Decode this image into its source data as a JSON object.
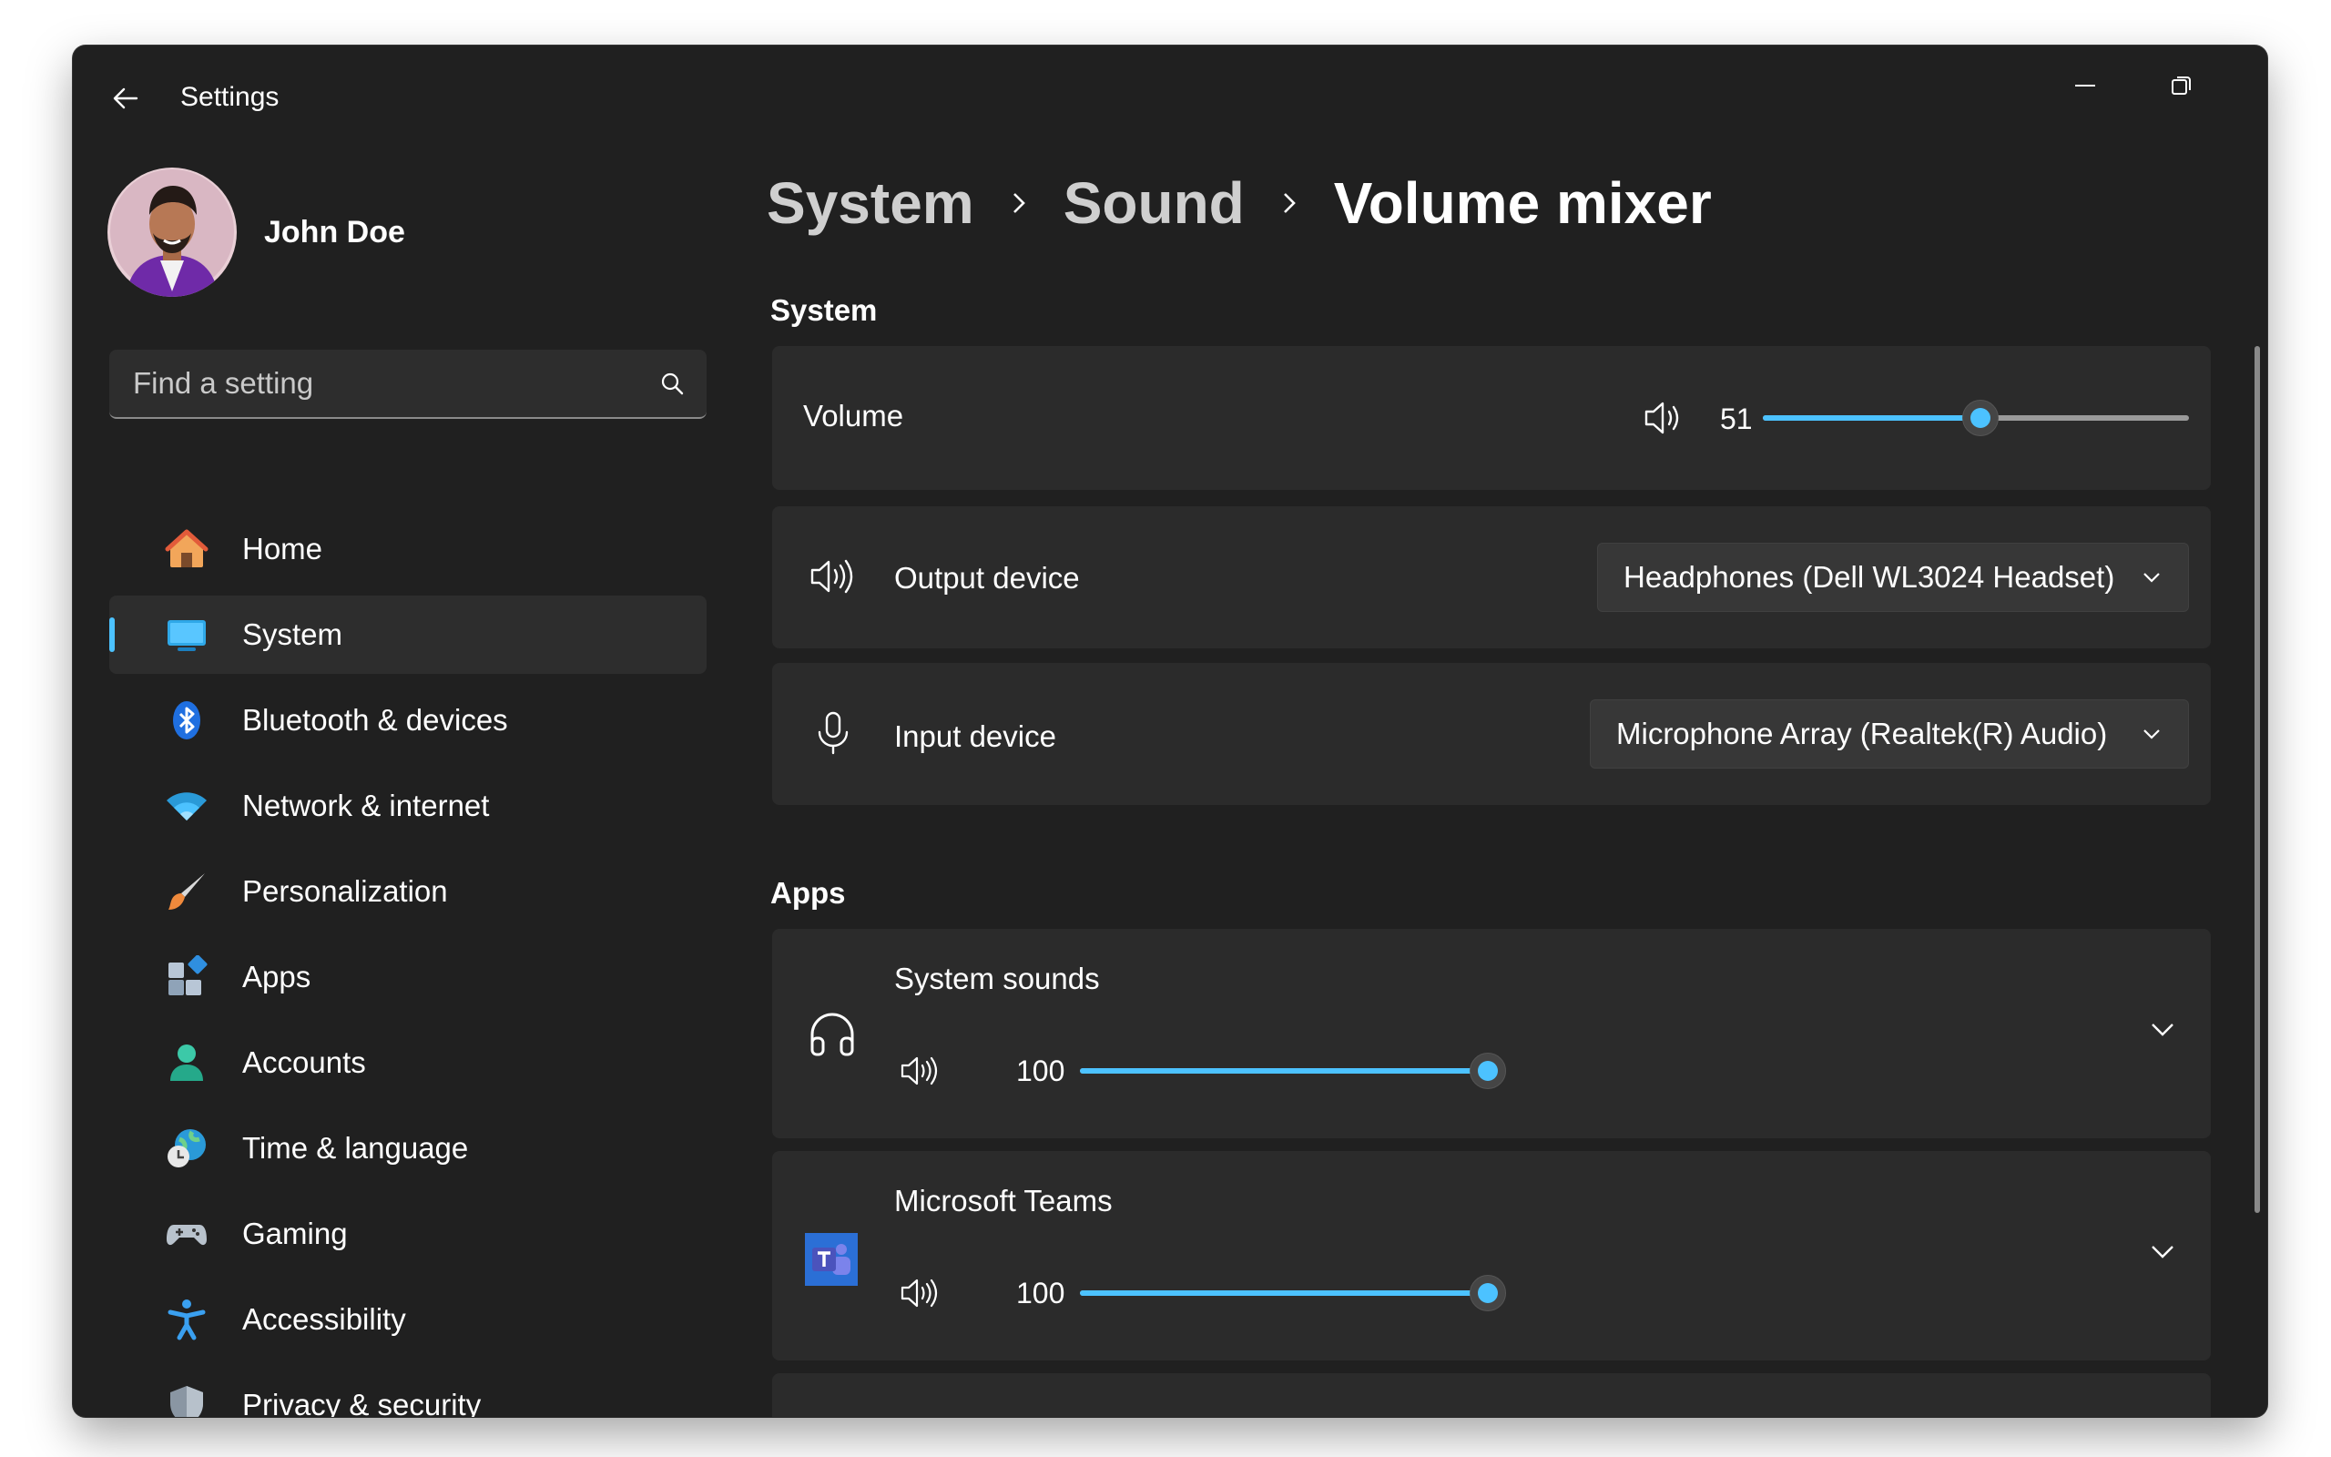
{
  "window": {
    "title": "Settings"
  },
  "profile": {
    "name": "John Doe"
  },
  "search": {
    "placeholder": "Find a setting"
  },
  "nav": {
    "items": [
      {
        "label": "Home",
        "icon": "home-icon"
      },
      {
        "label": "System",
        "icon": "system-icon",
        "selected": true
      },
      {
        "label": "Bluetooth & devices",
        "icon": "bluetooth-icon"
      },
      {
        "label": "Network & internet",
        "icon": "wifi-icon"
      },
      {
        "label": "Personalization",
        "icon": "brush-icon"
      },
      {
        "label": "Apps",
        "icon": "apps-icon"
      },
      {
        "label": "Accounts",
        "icon": "accounts-icon"
      },
      {
        "label": "Time & language",
        "icon": "globe-clock-icon"
      },
      {
        "label": "Gaming",
        "icon": "gamepad-icon"
      },
      {
        "label": "Accessibility",
        "icon": "accessibility-icon"
      },
      {
        "label": "Privacy & security",
        "icon": "shield-icon"
      }
    ]
  },
  "breadcrumb": {
    "level1": "System",
    "level2": "Sound",
    "current": "Volume mixer"
  },
  "system_section": {
    "title": "System",
    "volume": {
      "label": "Volume",
      "value": 51
    },
    "output": {
      "label": "Output device",
      "selected": "Headphones (Dell WL3024 Headset)"
    },
    "input": {
      "label": "Input device",
      "selected": "Microphone Array (Realtek(R) Audio)"
    }
  },
  "apps_section": {
    "title": "Apps",
    "apps": [
      {
        "name": "System sounds",
        "volume": 100,
        "icon": "headphones-icon"
      },
      {
        "name": "Microsoft Teams",
        "volume": 100,
        "icon": "teams-icon"
      }
    ]
  },
  "colors": {
    "accent": "#4cc2ff",
    "background": "#202020",
    "card": "#2b2b2b"
  }
}
